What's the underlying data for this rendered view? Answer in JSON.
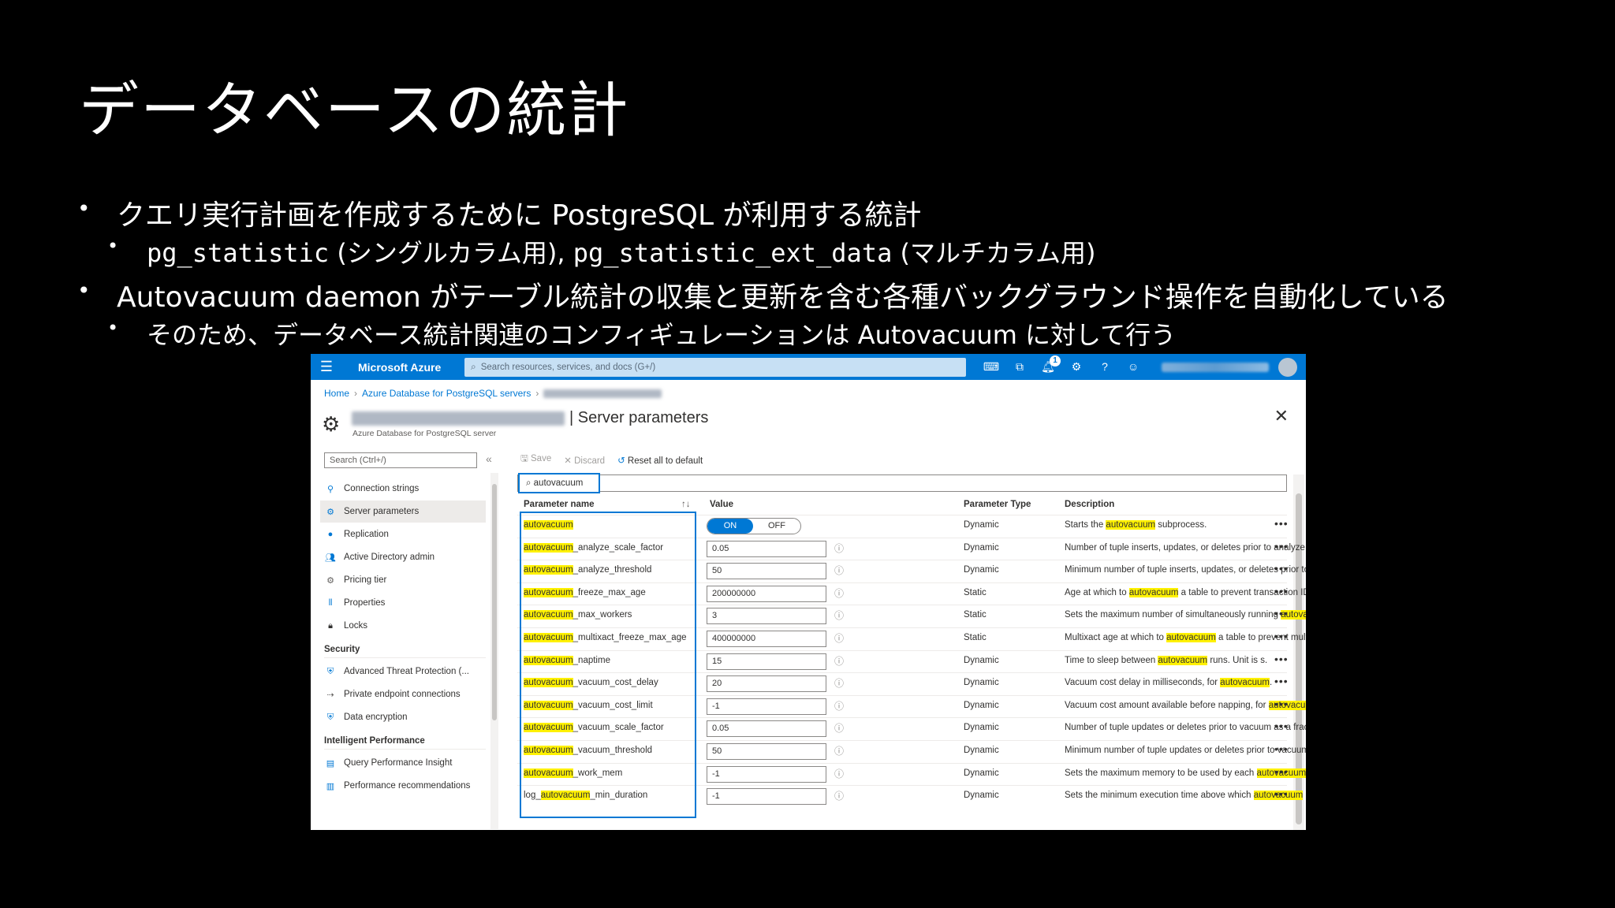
{
  "slide": {
    "title": "データベースの統計",
    "bullets": [
      {
        "text": "クエリ実行計画を作成するために PostgreSQL が利用する統計"
      },
      {
        "code1": "pg_statistic",
        "text1": " (シングルカラム用), ",
        "code2": "pg_statistic_ext_data",
        "text2": " (マルチカラム用)"
      },
      {
        "text": "Autovacuum daemon がテーブル統計の収集と更新を含む各種バックグラウンド操作を自動化している"
      },
      {
        "text": "そのため、データベース統計関連のコンフィギュレーションは Autovacuum に対して行う"
      }
    ]
  },
  "portal": {
    "brand": "Microsoft Azure",
    "search_placeholder": "Search resources, services, and docs (G+/)",
    "notification_count": "1",
    "breadcrumb": [
      "Home",
      "Azure Database for PostgreSQL servers"
    ],
    "blade_title": "| Server parameters",
    "blade_subtitle": "Azure Database for PostgreSQL server",
    "sidebar": {
      "search_placeholder": "Search (Ctrl+/)",
      "items": [
        {
          "label": "Connection strings",
          "icon": "plug-icon"
        },
        {
          "label": "Server parameters",
          "icon": "gear-icon",
          "selected": true
        },
        {
          "label": "Replication",
          "icon": "globe-icon"
        },
        {
          "label": "Active Directory admin",
          "icon": "users-icon"
        },
        {
          "label": "Pricing tier",
          "icon": "gear-icon"
        },
        {
          "label": "Properties",
          "icon": "bars-icon"
        },
        {
          "label": "Locks",
          "icon": "lock-icon"
        }
      ],
      "security_group": "Security",
      "security_items": [
        {
          "label": "Advanced Threat Protection (...",
          "icon": "shield-icon"
        },
        {
          "label": "Private endpoint connections",
          "icon": "link-icon"
        },
        {
          "label": "Data encryption",
          "icon": "shield-icon"
        }
      ],
      "perf_group": "Intelligent Performance",
      "perf_items": [
        {
          "label": "Query Performance Insight",
          "icon": "chart-icon"
        },
        {
          "label": "Performance recommendations",
          "icon": "chart-icon"
        }
      ]
    },
    "toolbar": {
      "save": "Save",
      "discard": "Discard",
      "reset": "Reset all to default"
    },
    "filter_value": "autovacuum",
    "columns": {
      "name": "Parameter name",
      "value": "Value",
      "type": "Parameter Type",
      "desc": "Description"
    },
    "toggle": {
      "on": "ON",
      "off": "OFF"
    },
    "rows": [
      {
        "pre": "",
        "hl": "autovacuum",
        "post": "",
        "value": "",
        "type": "Dynamic",
        "d_pre": "Starts the ",
        "d_hl": "autovacuum",
        "d_post": " subprocess."
      },
      {
        "pre": "",
        "hl": "autovacuum",
        "post": "_analyze_scale_factor",
        "value": "0.05",
        "type": "Dynamic",
        "d_pre": "Number of tuple inserts, updates, or deletes prior to analyze as...",
        "d_hl": "",
        "d_post": ""
      },
      {
        "pre": "",
        "hl": "autovacuum",
        "post": "_analyze_threshold",
        "value": "50",
        "type": "Dynamic",
        "d_pre": "Minimum number of tuple inserts, updates, or deletes prior to ...",
        "d_hl": "",
        "d_post": ""
      },
      {
        "pre": "",
        "hl": "autovacuum",
        "post": "_freeze_max_age",
        "value": "200000000",
        "type": "Static",
        "d_pre": "Age at which to ",
        "d_hl": "autovacuum",
        "d_post": " a table to prevent transaction ID ..."
      },
      {
        "pre": "",
        "hl": "autovacuum",
        "post": "_max_workers",
        "value": "3",
        "type": "Static",
        "d_pre": "Sets the maximum number of simultaneously running ",
        "d_hl": "autovacu...",
        "d_post": ""
      },
      {
        "pre": "",
        "hl": "autovacuum",
        "post": "_multixact_freeze_max_age",
        "value": "400000000",
        "type": "Static",
        "d_pre": "Multixact age at which to ",
        "d_hl": "autovacuum",
        "d_post": " a table to prevent multix..."
      },
      {
        "pre": "",
        "hl": "autovacuum",
        "post": "_naptime",
        "value": "15",
        "type": "Dynamic",
        "d_pre": "Time to sleep between ",
        "d_hl": "autovacuum",
        "d_post": " runs. Unit is s."
      },
      {
        "pre": "",
        "hl": "autovacuum",
        "post": "_vacuum_cost_delay",
        "value": "20",
        "type": "Dynamic",
        "d_pre": "Vacuum cost delay in milliseconds, for ",
        "d_hl": "autovacuum",
        "d_post": "."
      },
      {
        "pre": "",
        "hl": "autovacuum",
        "post": "_vacuum_cost_limit",
        "value": "-1",
        "type": "Dynamic",
        "d_pre": "Vacuum cost amount available before napping, for ",
        "d_hl": "autovacuum",
        "d_post": "."
      },
      {
        "pre": "",
        "hl": "autovacuum",
        "post": "_vacuum_scale_factor",
        "value": "0.05",
        "type": "Dynamic",
        "d_pre": "Number of tuple updates or deletes prior to vacuum as a fracti...",
        "d_hl": "",
        "d_post": ""
      },
      {
        "pre": "",
        "hl": "autovacuum",
        "post": "_vacuum_threshold",
        "value": "50",
        "type": "Dynamic",
        "d_pre": "Minimum number of tuple updates or deletes prior to vacuum.",
        "d_hl": "",
        "d_post": ""
      },
      {
        "pre": "",
        "hl": "autovacuum",
        "post": "_work_mem",
        "value": "-1",
        "type": "Dynamic",
        "d_pre": "Sets the maximum memory to be used by each ",
        "d_hl": "autovacuum",
        "d_post": " w..."
      },
      {
        "pre": "log_",
        "hl": "autovacuum",
        "post": "_min_duration",
        "value": "-1",
        "type": "Dynamic",
        "d_pre": "Sets the minimum execution time above which ",
        "d_hl": "autovacuum",
        "d_post": " act..."
      }
    ]
  }
}
